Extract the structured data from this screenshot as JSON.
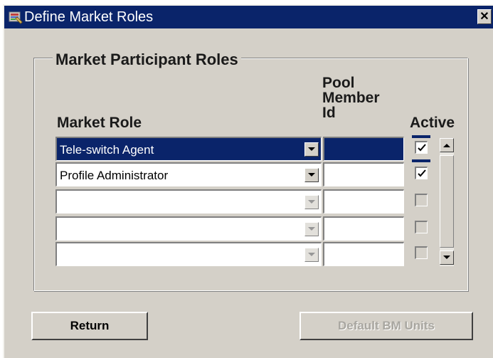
{
  "window": {
    "title": "Define Market Roles",
    "close_icon": "close-icon",
    "app_icon": "forms-app-icon"
  },
  "group": {
    "title": "Market Participant Roles"
  },
  "columns": {
    "market_role": "Market Role",
    "pool_member_id": "Pool Member Id",
    "active": "Active"
  },
  "rows": [
    {
      "market_role": "Tele-switch Agent",
      "pool_member_id": "",
      "active": true,
      "selected": true
    },
    {
      "market_role": "Profile Administrator",
      "pool_member_id": "",
      "active": true,
      "selected": false
    },
    {
      "market_role": "",
      "pool_member_id": "",
      "active": false,
      "selected": false
    },
    {
      "market_role": "",
      "pool_member_id": "",
      "active": false,
      "selected": false
    },
    {
      "market_role": "",
      "pool_member_id": "",
      "active": false,
      "selected": false
    }
  ],
  "buttons": {
    "return_label": "Return",
    "default_bm_units_label": "Default BM Units"
  },
  "colors": {
    "titlebar": "#0a246a",
    "face": "#d4d0c8",
    "selection": "#0a246a"
  }
}
